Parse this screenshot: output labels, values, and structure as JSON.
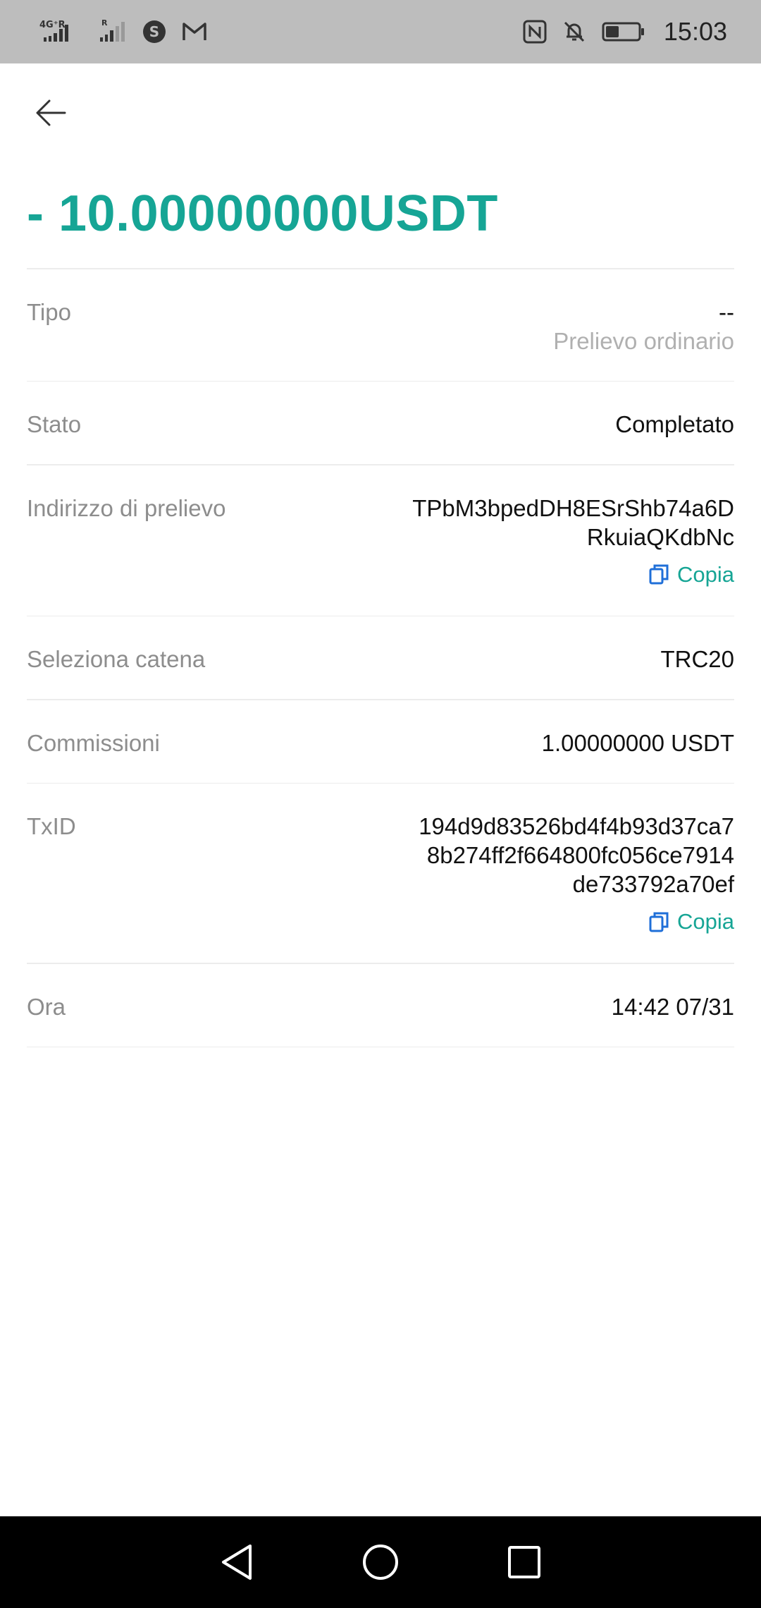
{
  "status_bar": {
    "network_label": "4G⁺R",
    "time": "15:03",
    "colors": {
      "bg": "#bdbdbd"
    },
    "icons": [
      "signal-4g-icon",
      "signal-r-icon",
      "app-s-icon",
      "mail-m-icon",
      "nfc-icon",
      "silent-bell-icon",
      "battery-icon"
    ]
  },
  "header": {
    "back_icon": "arrow-left-icon",
    "amount": "- 10.00000000USDT"
  },
  "details": {
    "tipo": {
      "label": "Tipo",
      "value": "--",
      "sub": "Prelievo ordinario"
    },
    "stato": {
      "label": "Stato",
      "value": "Completato"
    },
    "indirizzo": {
      "label": "Indirizzo di prelievo",
      "line1": "TPbM3bpedDH8ESrShb74a6D",
      "line2": "RkuiaQKdbNc",
      "copy_label": "Copia"
    },
    "catena": {
      "label": "Seleziona catena",
      "value": "TRC20"
    },
    "commissioni": {
      "label": "Commissioni",
      "value": "1.00000000 USDT"
    },
    "txid": {
      "label": "TxID",
      "line1": "194d9d83526bd4f4b93d37ca7",
      "line2": "8b274ff2f664800fc056ce7914",
      "line3": "de733792a70ef",
      "copy_label": "Copia"
    },
    "ora": {
      "label": "Ora",
      "value": "14:42 07/31"
    }
  },
  "colors": {
    "accent": "#16a595",
    "copy_icon": "#1f6fd8",
    "label": "#8d8d8d"
  },
  "navbar": {
    "icons": [
      "nav-back-icon",
      "nav-home-icon",
      "nav-recents-icon"
    ]
  }
}
